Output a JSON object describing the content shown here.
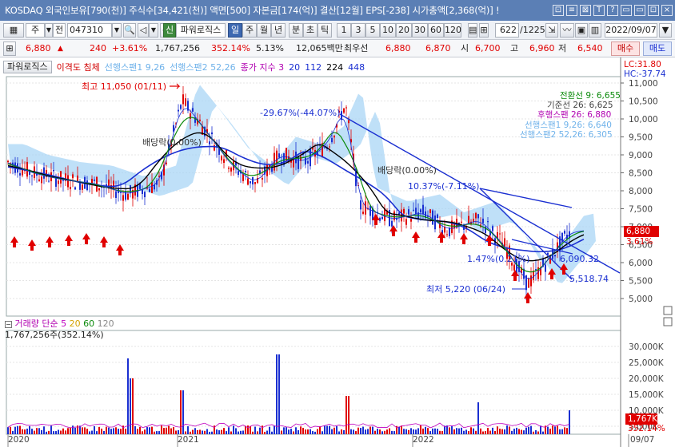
{
  "titlebar": {
    "text": "KOSDAQ 외국인보유[790(천)] 주식수[34,421(천)] 액면[500] 자본금[174(억)] 결산[12월] EPS[-238] 시가총액[2,368(억)] !",
    "controls": [
      "⊡",
      "≡",
      "⊠",
      "T",
      "?",
      "▭",
      "▭",
      "⊡",
      "×"
    ]
  },
  "toolbar1": {
    "type1": "주",
    "type2": "전",
    "code": "047310",
    "indicator_label": "신",
    "indicator_name": "파워로직스",
    "periods": [
      "일",
      "주",
      "월",
      "년",
      "분",
      "초",
      "틱"
    ],
    "selected_period": "일",
    "intervals": [
      "1",
      "3",
      "5",
      "10",
      "20",
      "30",
      "60",
      "120"
    ],
    "count": "622",
    "total": "/1225",
    "date": "2022/09/07"
  },
  "quote": {
    "price": "6,880",
    "arrow": "▲",
    "change": "240",
    "change_pct": "+3.61%",
    "volume": "1,767,256",
    "volume_pct": "352.14%",
    "turnover_pct": "5.13%",
    "amount": "12,065백만",
    "best_label": "최우선",
    "best_ask": "6,880",
    "best_bid": "6,870",
    "open_label": "시",
    "open": "6,700",
    "high_label": "고",
    "high": "6,960",
    "low_label": "저",
    "low": "6,540",
    "buy_label": "매수",
    "sell_label": "매도"
  },
  "price_pane": {
    "button": "파워로직스",
    "legend": [
      {
        "text": "이격도 침체",
        "color": "#d10000"
      },
      {
        "text": "선행스팬1 9,26",
        "color": "#6fb2ea"
      },
      {
        "text": "선행스팬2 52,26",
        "color": "#6fb2ea"
      },
      {
        "text": "종가 지수 3",
        "color": "#b000b0"
      },
      {
        "text": "20",
        "color": "#1a2fd1"
      },
      {
        "text": "112",
        "color": "#1a2fd1"
      },
      {
        "text": "224",
        "color": "#000"
      },
      {
        "text": "448",
        "color": "#1a2fd1"
      }
    ],
    "lc": "LC:31.80",
    "hc": "HC:-37.74",
    "high_note": "최고 11,050 (01/11)",
    "low_note": "최저 5,220 (06/24)",
    "pct_note": "-29.67%(-44.07%)",
    "div_note_1": "배당락(0.00%)",
    "div_note_2": "배당락(0.00%)",
    "mid_note": "10.37%(-7.11%)",
    "note_147": "1.47%(0.21%)",
    "note_6090": "6,090.32",
    "note_5518": "5,518.74",
    "ichimoku": [
      {
        "text": "전환선 9: 6,655",
        "color": "#0b8a0b"
      },
      {
        "text": "기준선 26: 6,625",
        "color": "#444"
      },
      {
        "text": "후행스팬 26: 6,880",
        "color": "#b000b0"
      },
      {
        "text": "선행스팬1 9,26: 6,640",
        "color": "#6fb2ea"
      },
      {
        "text": "선행스팬2 52,26: 6,305",
        "color": "#6fb2ea"
      }
    ],
    "price_tag": "6,880",
    "pct_tag": "3.61%",
    "y_ticks": [
      "11,000",
      "10,500",
      "10,000",
      "9,500",
      "9,000",
      "8,500",
      "8,000",
      "7,500",
      "7,000",
      "6,500",
      "6,000",
      "5,500",
      "5,000"
    ]
  },
  "volume_pane": {
    "label": "거래량",
    "ma_label": "단순",
    "ma": [
      {
        "text": "5",
        "color": "#c000c0"
      },
      {
        "text": "20",
        "color": "#d4a200"
      },
      {
        "text": "60",
        "color": "#0b8a0b"
      },
      {
        "text": "120",
        "color": "#888"
      }
    ],
    "value": "1,767,256주(352.14%)",
    "y_ticks": [
      "30,000K",
      "25,000K",
      "20,000K",
      "15,000K",
      "10,000K",
      "5,000K"
    ],
    "vol_tag": "1,767K",
    "vol_pct_tag": "352.14%"
  },
  "x_axis": {
    "labels": [
      "2020",
      "2021",
      "2022"
    ],
    "end_label": "09/07"
  },
  "colors": {
    "up": "#e00000",
    "down": "#1a2fd1",
    "cloud": "#8fc9f2",
    "title": "#5b7fb5"
  }
}
